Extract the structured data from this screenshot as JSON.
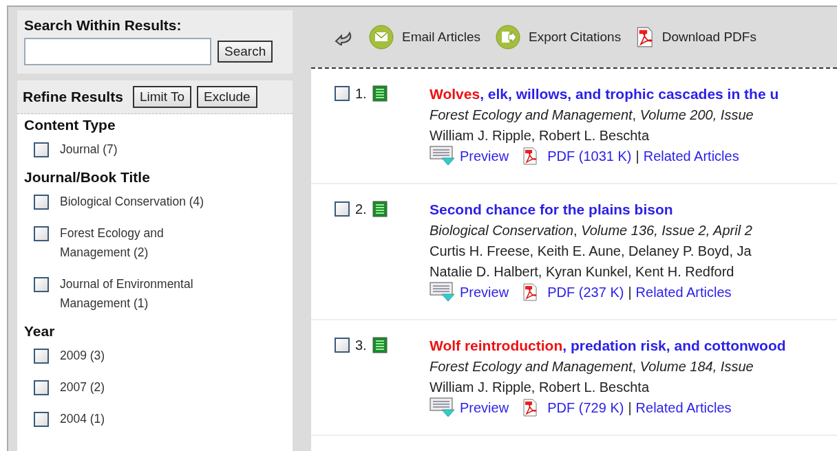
{
  "search": {
    "heading": "Search Within Results:",
    "button": "Search"
  },
  "refine": {
    "heading": "Refine Results",
    "buttons": [
      "Limit To",
      "Exclude"
    ],
    "groups": [
      {
        "title": "Content Type",
        "options": [
          {
            "label": "Journal (7)",
            "checked": false
          }
        ]
      },
      {
        "title": "Journal/Book Title",
        "options": [
          {
            "label": "Biological Conservation (4)",
            "checked": false
          },
          {
            "label": "Forest Ecology and Management (2)",
            "checked": false
          },
          {
            "label": "Journal of Environmental Management (1)",
            "checked": false
          }
        ]
      },
      {
        "title": "Year",
        "options": [
          {
            "label": "2009 (3)",
            "checked": false
          },
          {
            "label": "2007 (2)",
            "checked": false
          },
          {
            "label": "2004 (1)",
            "checked": false
          }
        ]
      }
    ]
  },
  "toolbar": [
    {
      "kind": "back"
    },
    {
      "kind": "email",
      "label": "Email Articles"
    },
    {
      "kind": "export",
      "label": "Export Citations"
    },
    {
      "kind": "pdf",
      "label": "Download PDFs"
    }
  ],
  "results": [
    {
      "number": "1.",
      "checked": false,
      "title_parts": [
        {
          "text": "Wolves",
          "highlighted": true
        },
        {
          "text": ", elk, willows, and trophic cascades in the u",
          "highlighted": false
        }
      ],
      "source": "*Forest Ecology and Management*, *Volume 200, Issue*",
      "authors": [
        "William J. Ripple, Robert L. Beschta"
      ],
      "preview": "Preview",
      "pdf": "PDF (1031 K)",
      "separator": "|",
      "related": "Related Articles"
    },
    {
      "number": "2.",
      "checked": false,
      "title_parts": [
        {
          "text": "Second chance for the plains bison",
          "highlighted": false
        }
      ],
      "source": "*Biological Conservation*, *Volume 136, Issue 2, April 2*",
      "authors": [
        "Curtis H. Freese, Keith E. Aune, Delaney P. Boyd, Ja",
        "Natalie D. Halbert, Kyran Kunkel, Kent H. Redford"
      ],
      "preview": "Preview",
      "pdf": "PDF (237 K)",
      "separator": "|",
      "related": "Related Articles"
    },
    {
      "number": "3.",
      "checked": false,
      "title_parts": [
        {
          "text": "Wolf reintroduction",
          "highlighted": true
        },
        {
          "text": ", predation risk, and cottonwood",
          "highlighted": false
        }
      ],
      "source": "*Forest Ecology and Management*, *Volume 184, Issue*",
      "authors": [
        "William J. Ripple, Robert L. Beschta"
      ],
      "preview": "Preview",
      "pdf": "PDF (729 K)",
      "separator": "|",
      "related": "Related Articles"
    }
  ]
}
